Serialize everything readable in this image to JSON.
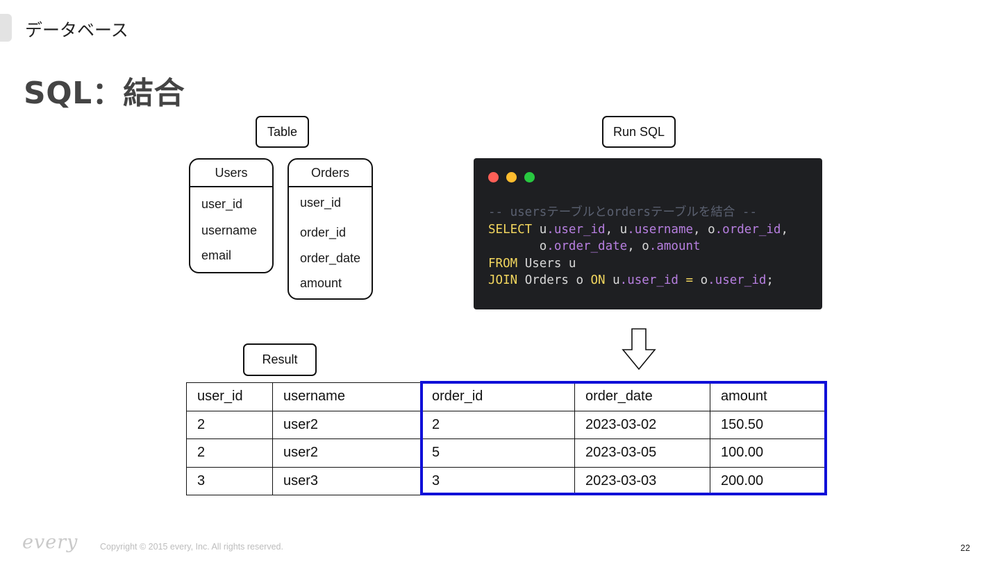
{
  "header": {
    "section": "データベース",
    "title": "SQL：結合"
  },
  "labels": {
    "table": "Table",
    "run_sql": "Run SQL",
    "result": "Result"
  },
  "users_table": {
    "name": "Users",
    "fields": [
      "user_id",
      "username",
      "email"
    ]
  },
  "orders_table": {
    "name": "Orders",
    "fields": [
      "user_id",
      "order_id",
      "order_date",
      "amount"
    ]
  },
  "code_window": {
    "dot_colors": [
      "#ff5f57",
      "#febc2e",
      "#28c840"
    ]
  },
  "sql": {
    "comment": "-- usersテーブルとordersテーブルを結合 --",
    "l2": {
      "kw": "SELECT",
      "a1": " u",
      "c1": ".user_id",
      "s1": ", u",
      "c2": ".username",
      "s2": ", o",
      "c3": ".order_id",
      "s3": ","
    },
    "l3": {
      "indent": "       o",
      "c1": ".order_date",
      "s1": ", o",
      "c2": ".amount"
    },
    "l4": {
      "kw": "FROM",
      "rest": " Users u"
    },
    "l5": {
      "kw": "JOIN",
      "a1": " Orders o ",
      "kw2": "ON",
      "a2": " u",
      "c1": ".user_id",
      "op": " = ",
      "a3": "o",
      "c2": ".user_id",
      "end": ";"
    }
  },
  "result": {
    "columns": [
      "user_id",
      "username",
      "order_id",
      "order_date",
      "amount"
    ],
    "rows": [
      [
        "2",
        "user2",
        "2",
        "2023-03-02",
        "150.50"
      ],
      [
        "2",
        "user2",
        "5",
        "2023-03-05",
        "100.00"
      ],
      [
        "3",
        "user3",
        "3",
        "2023-03-03",
        "200.00"
      ]
    ]
  },
  "highlight_color": "#1010d8",
  "footer": {
    "logo": "every",
    "copyright": "Copyright © 2015 every, Inc. All rights reserved.",
    "page": "22"
  }
}
